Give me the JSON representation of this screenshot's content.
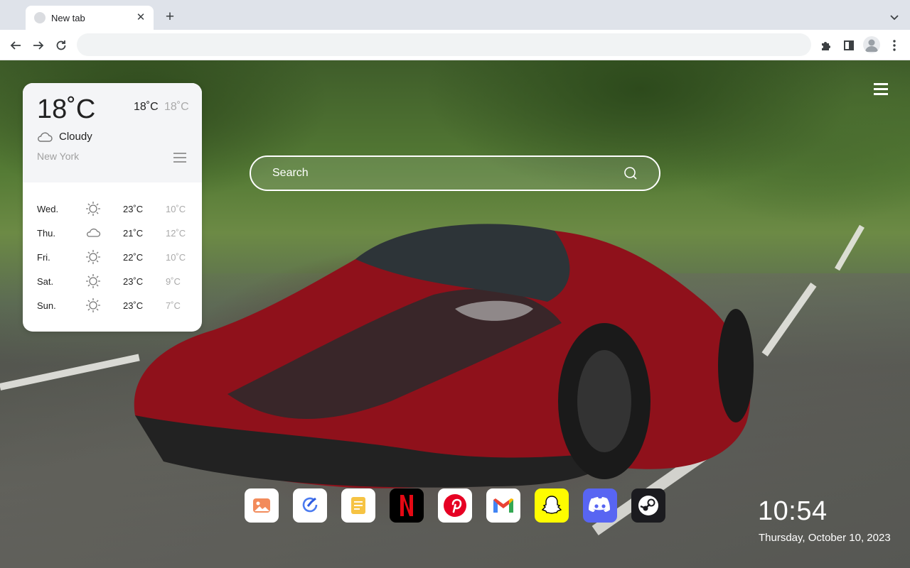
{
  "browser": {
    "tab_title": "New tab",
    "omnibox_value": ""
  },
  "weather": {
    "current_temp": "18˚C",
    "high": "18˚C",
    "low": "18˚C",
    "condition": "Cloudy",
    "condition_icon": "cloud-icon",
    "city": "New York",
    "forecast": [
      {
        "day": "Wed.",
        "icon": "sun-icon",
        "high": "23˚C",
        "low": "10˚C"
      },
      {
        "day": "Thu.",
        "icon": "cloud-icon",
        "high": "21˚C",
        "low": "12˚C"
      },
      {
        "day": "Fri.",
        "icon": "sun-icon",
        "high": "22˚C",
        "low": "10˚C"
      },
      {
        "day": "Sat.",
        "icon": "sun-icon",
        "high": "23˚C",
        "low": "9˚C"
      },
      {
        "day": "Sun.",
        "icon": "sun-icon",
        "high": "23˚C",
        "low": "7˚C"
      }
    ]
  },
  "search": {
    "placeholder": "Search"
  },
  "dock": {
    "apps": [
      {
        "name": "photos",
        "bg": "#ffffff"
      },
      {
        "name": "tasks",
        "bg": "#ffffff"
      },
      {
        "name": "notes",
        "bg": "#ffffff"
      },
      {
        "name": "netflix",
        "bg": "#000000"
      },
      {
        "name": "pinterest",
        "bg": "#ffffff"
      },
      {
        "name": "gmail",
        "bg": "#ffffff"
      },
      {
        "name": "snapchat",
        "bg": "#fffc00"
      },
      {
        "name": "discord",
        "bg": "#5865f2"
      },
      {
        "name": "steam",
        "bg": "#1b1b1f"
      }
    ]
  },
  "clock": {
    "time": "10:54",
    "date": "Thursday, October 10, 2023"
  },
  "colors": {
    "chrome_bg": "#dfe3ea",
    "car_red": "#a3151f"
  }
}
